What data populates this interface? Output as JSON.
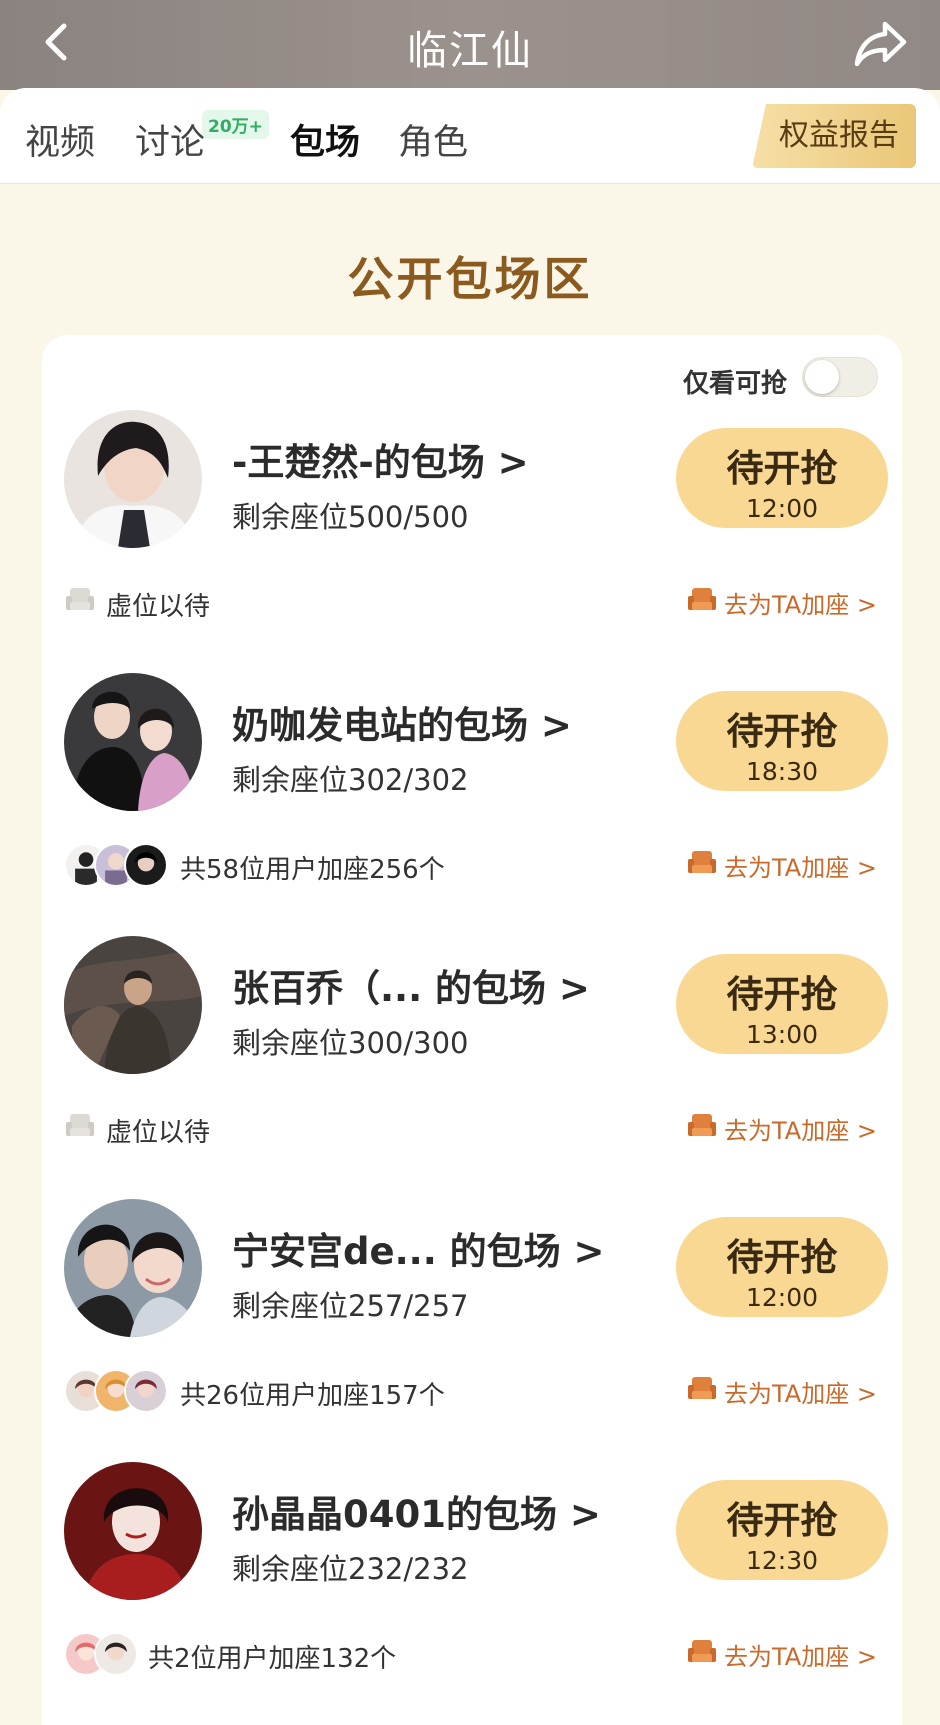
{
  "header": {
    "title": "临江仙"
  },
  "tabs": [
    {
      "label": "视频"
    },
    {
      "label": "讨论",
      "badge": "20万+"
    },
    {
      "label": "包场"
    },
    {
      "label": "角色"
    }
  ],
  "report_button": "权益报告",
  "section_title": "公开包场区",
  "filter": {
    "label": "仅看可抢",
    "enabled": false
  },
  "join_link": "去为TA加座 >",
  "grab_label": "待开抢",
  "items": [
    {
      "title": "-王楚然-的包场 >",
      "seats": "剩余座位500/500",
      "time": "12:00",
      "sub": "虚位以待"
    },
    {
      "title": "奶咖发电站的包场 >",
      "seats": "剩余座位302/302",
      "time": "18:30",
      "sub": "共58位用户加座256个"
    },
    {
      "title": "张百乔（... 的包场 >",
      "seats": "剩余座位300/300",
      "time": "13:00",
      "sub": "虚位以待"
    },
    {
      "title": "宁安宫de... 的包场 >",
      "seats": "剩余座位257/257",
      "time": "12:00",
      "sub": "共26位用户加座157个"
    },
    {
      "title": "孙晶晶0401的包场 >",
      "seats": "剩余座位232/232",
      "time": "12:30",
      "sub": "共2位用户加座132个"
    }
  ],
  "colors": {
    "accent": "#c9692a",
    "button": "#f9d894",
    "section_title": "#8a5a1e",
    "background": "#fbf7e8"
  }
}
